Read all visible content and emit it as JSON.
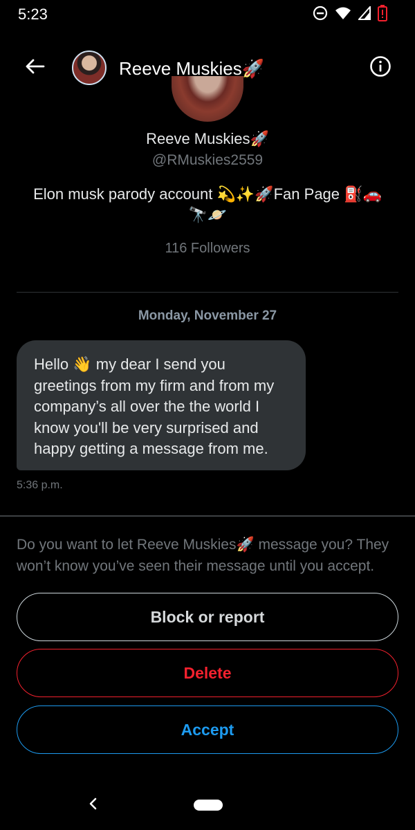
{
  "status_bar": {
    "time": "5:23",
    "icons": [
      "do-not-disturb-icon",
      "wifi-icon",
      "signal-icon",
      "battery-low-icon"
    ],
    "battery_color": "#f4212e"
  },
  "header": {
    "title": "Reeve Muskies🚀",
    "back_icon": "back-arrow-icon",
    "info_icon": "info-icon"
  },
  "profile": {
    "name": "Reeve Muskies🚀",
    "handle": "@RMuskies2559",
    "bio": "Elon musk parody account 💫✨🚀Fan Page ⛽🚗🔭🪐",
    "followers": "116 Followers"
  },
  "conversation": {
    "date": "Monday, November 27",
    "messages": [
      {
        "text": "Hello 👋 my dear I send you greetings from my firm and from my company’s all over the the world I know you'll be very surprised and happy getting a message from me.",
        "time": "5:36 p.m."
      }
    ]
  },
  "request": {
    "prompt": "Do you want to let Reeve Muskies🚀 message you? They won’t know you’ve seen their message until you accept.",
    "block_label": "Block or report",
    "delete_label": "Delete",
    "accept_label": "Accept"
  },
  "colors": {
    "background": "#000000",
    "accent": "#1d9bf0",
    "danger": "#f4212e",
    "bubble": "#2f3336",
    "secondary_text": "#71767b"
  }
}
